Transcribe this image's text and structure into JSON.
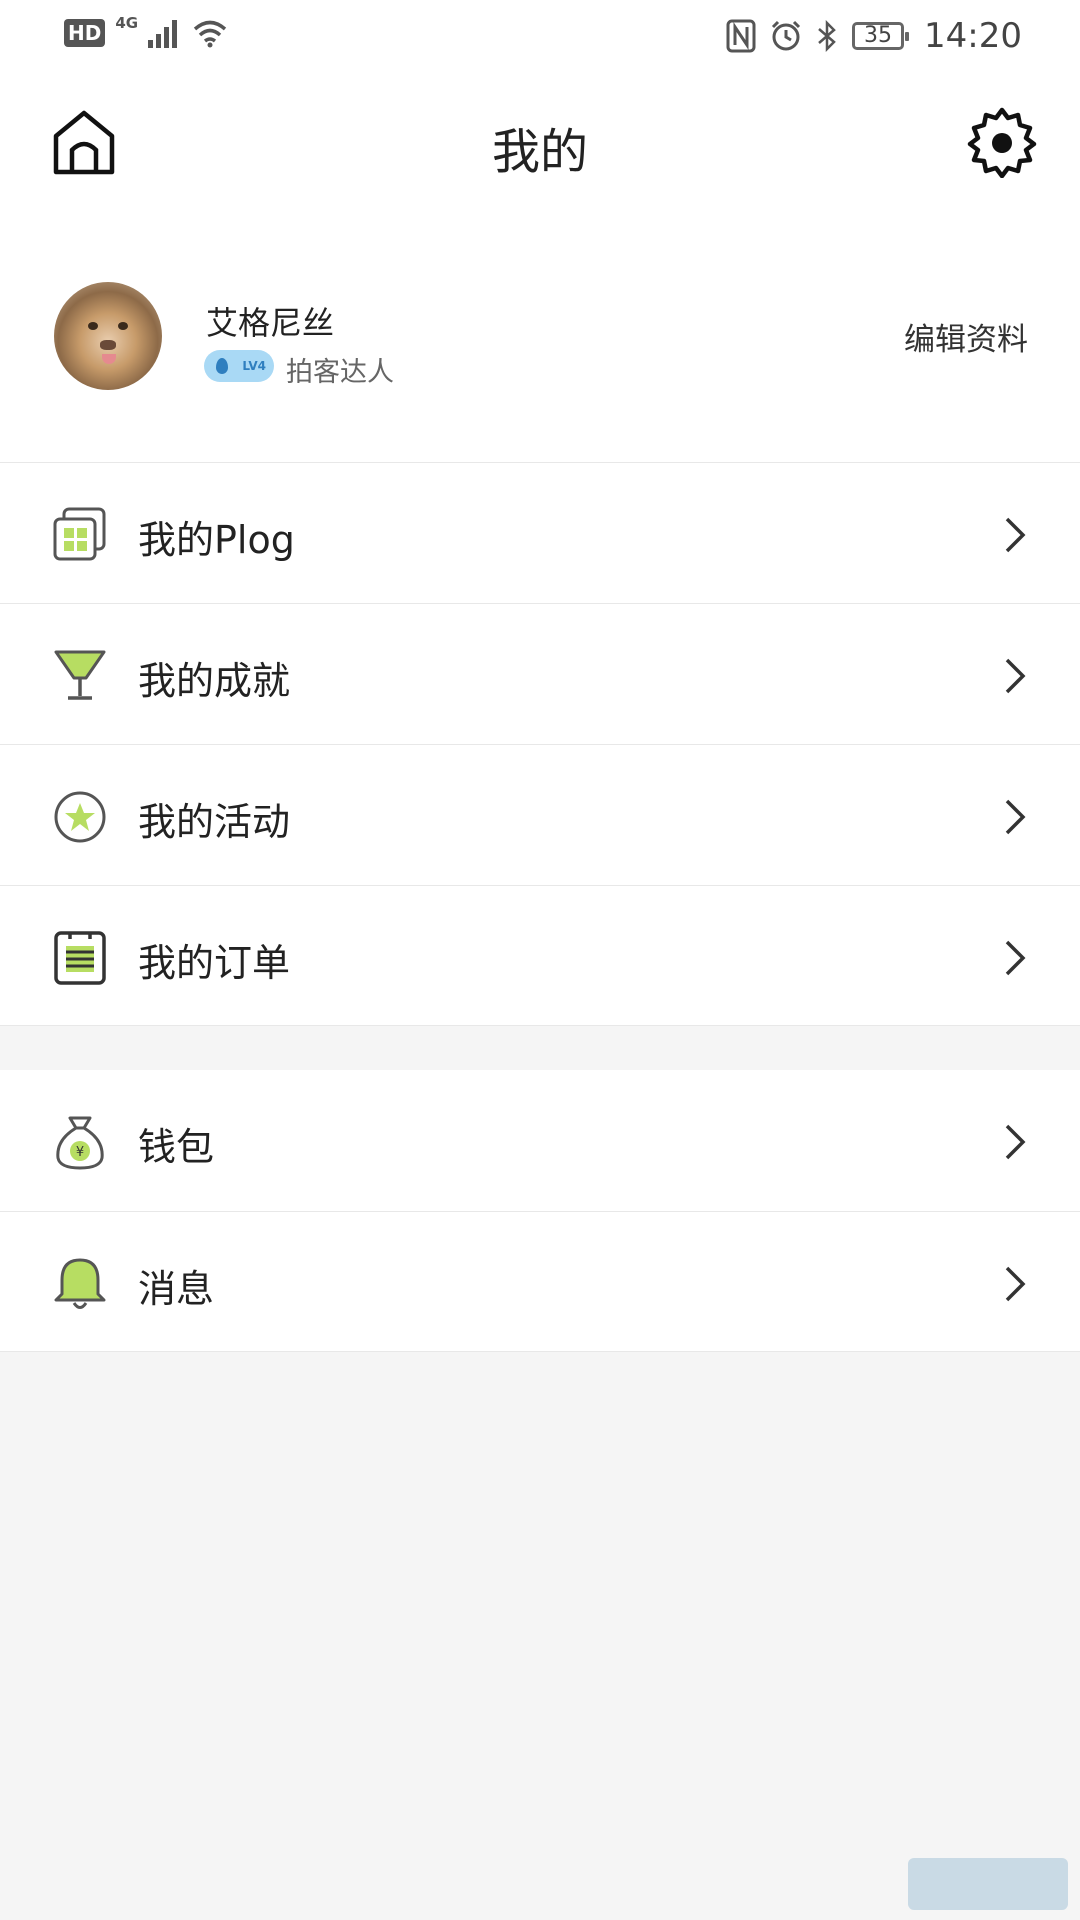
{
  "status_bar": {
    "hd": "HD",
    "network": "4G",
    "battery": "35",
    "time": "14:20"
  },
  "header": {
    "title": "我的"
  },
  "profile": {
    "name": "艾格尼丝",
    "level_badge": "LV4",
    "level_title": "拍客达人",
    "edit_label": "编辑资料"
  },
  "menu_group_1": [
    {
      "label": "我的Plog",
      "icon": "plog-gallery-icon"
    },
    {
      "label": "我的成就",
      "icon": "trophy-icon"
    },
    {
      "label": "我的活动",
      "icon": "star-badge-icon"
    },
    {
      "label": "我的订单",
      "icon": "order-clipboard-icon"
    }
  ],
  "menu_group_2": [
    {
      "label": "钱包",
      "icon": "money-bag-icon"
    },
    {
      "label": "消息",
      "icon": "bell-icon"
    }
  ],
  "colors": {
    "accent_green": "#b7dd62",
    "icon_stroke": "#555555",
    "badge_blue": "#a9d9f5",
    "background": "#f5f5f5"
  }
}
